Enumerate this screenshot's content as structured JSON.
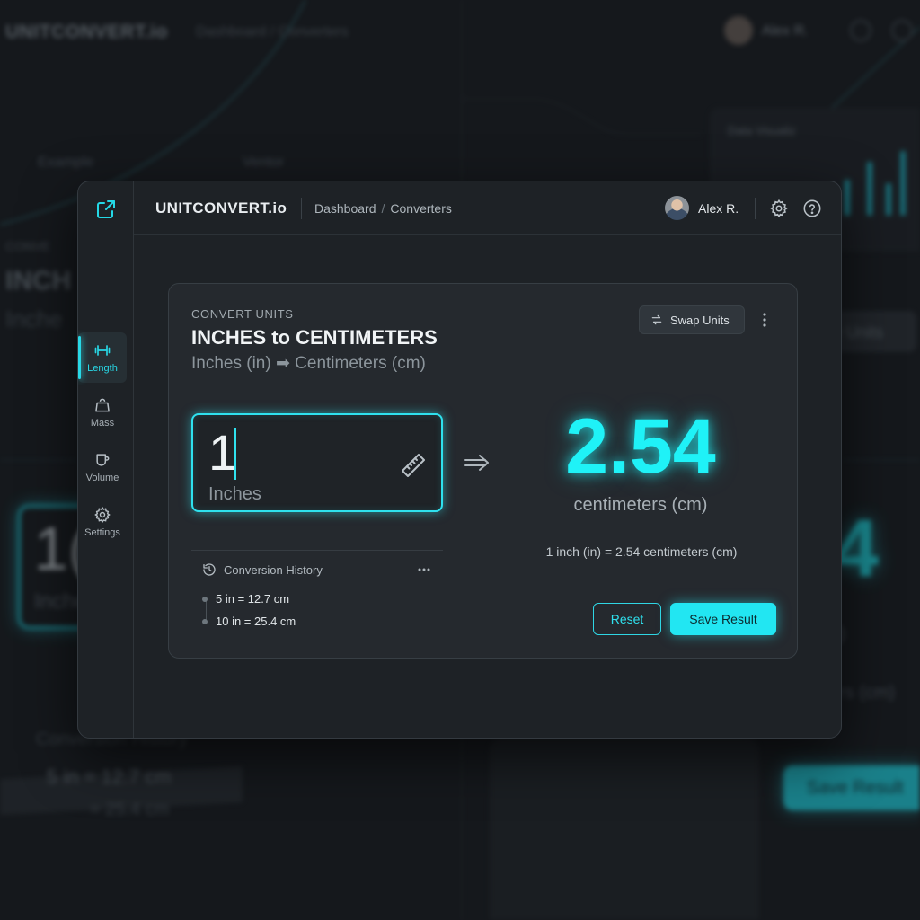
{
  "colors": {
    "accent": "#22e6f2",
    "window_bg": "#1e2226",
    "card_bg": "#25292e",
    "page_bg": "#15181c"
  },
  "background": {
    "brand": "UNITCONVERT.io",
    "breadcrumb": "Dashboard / Converters",
    "user": "Alex R.",
    "tab_left": "Example",
    "tab_right": "Ventor",
    "panel_title": "Data Visualiz",
    "left_overline": "CONVE",
    "left_title": "INCH",
    "left_sub": "Inche",
    "left_input_value": "1(",
    "left_input_unit": "Inche",
    "right_result": "4",
    "swap_label": "y Units",
    "save_label": "Save Result",
    "hist_head": "Conversion History",
    "hist_1": "5 in = 12.7 cm",
    "hist_2": "= 25.4 cm",
    "right_small_1": ")",
    "right_small_2": "rs (cm)"
  },
  "header": {
    "brand": "UNITCONVERT.io",
    "breadcrumb": [
      "Dashboard",
      "Converters"
    ],
    "user_name": "Alex R.",
    "icons": [
      "settings-icon",
      "help-icon"
    ]
  },
  "sidebar": {
    "items": [
      {
        "label": "Length",
        "icon": "dumbbell-icon",
        "active": true
      },
      {
        "label": "Mass",
        "icon": "weight-bag-icon",
        "active": false
      },
      {
        "label": "Volume",
        "icon": "cup-icon",
        "active": false
      },
      {
        "label": "Settings",
        "icon": "gear-icon",
        "active": false
      }
    ]
  },
  "converter": {
    "overline": "CONVERT UNITS",
    "title": "INCHES to CENTIMETERS",
    "subtitle": "Inches (in) ➡ Centimeters (cm)",
    "swap_label": "Swap Units",
    "input_value": "1",
    "input_unit": "Inches",
    "result_value": "2.54",
    "result_unit": "centimeters (cm)",
    "formula": "1 inch (in) = 2.54 centimeters (cm)",
    "reset_label": "Reset",
    "save_label": "Save Result",
    "history": {
      "title": "Conversion History",
      "items": [
        "5 in = 12.7 cm",
        "10 in = 25.4 cm"
      ]
    }
  }
}
